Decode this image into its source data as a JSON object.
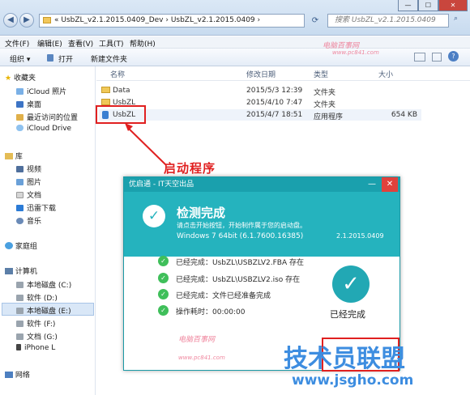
{
  "address": {
    "breadcrumb": "« UsbZL_v2.1.2015.0409_Dev › UsbZL_v2.1.2015.0409 ›"
  },
  "search": {
    "placeholder": "搜索 UsbZL_v2.1.2015.0409"
  },
  "menu": [
    "文件(F)",
    "编辑(E)",
    "查看(V)",
    "工具(T)",
    "帮助(H)"
  ],
  "toolbar": {
    "organize": "组织 ▾",
    "open": "打开",
    "new_folder": "新建文件夹"
  },
  "sidebar": {
    "favorites": "收藏夹",
    "favorites_items": [
      "iCloud 照片",
      "桌面",
      "最近访问的位置",
      "iCloud Drive"
    ],
    "library": "库",
    "library_items": [
      "视频",
      "图片",
      "文档",
      "迅雷下载",
      "音乐"
    ],
    "homegroup": "家庭组",
    "computer": "计算机",
    "drives": [
      "本地磁盘 (C:)",
      "软件 (D:)",
      "本地磁盘 (E:)",
      "软件 (F:)",
      "文档 (G:)",
      "iPhone L"
    ],
    "network": "网络"
  },
  "columns": {
    "name": "名称",
    "date": "修改日期",
    "type": "类型",
    "size": "大小"
  },
  "files": [
    {
      "name": "Data",
      "date": "2015/5/3 12:39",
      "type": "文件夹",
      "size": ""
    },
    {
      "name": "UsbZL",
      "date": "2015/4/10 7:47",
      "type": "文件夹",
      "size": ""
    },
    {
      "name": "UsbZL",
      "date": "2015/4/7 18:51",
      "type": "应用程序",
      "size": "654 KB"
    }
  ],
  "annotation": "启动程序",
  "dialog": {
    "title": "优启通 - IT天空出品",
    "heading": "检测完成",
    "subtitle": "请点击开始按钮，开始制作属于您的启动盘。",
    "os": "Windows 7 64bit (6.1.7600.16385)",
    "version": "2.1.2015.0409",
    "steps": [
      "已经完成：UsbZL\\USBZLV2.FBA 存在",
      "已经完成：UsbZL\\USBZLV2.iso 存在",
      "已经完成：文件已经准备完成",
      "操作耗时：00:00:00"
    ],
    "status": "已经完成"
  },
  "watermark": {
    "brand": "电脑百事网",
    "url": "www.pc841.com"
  },
  "site_watermark": {
    "title": "技术员联盟",
    "url": "www.jsgho.com"
  }
}
